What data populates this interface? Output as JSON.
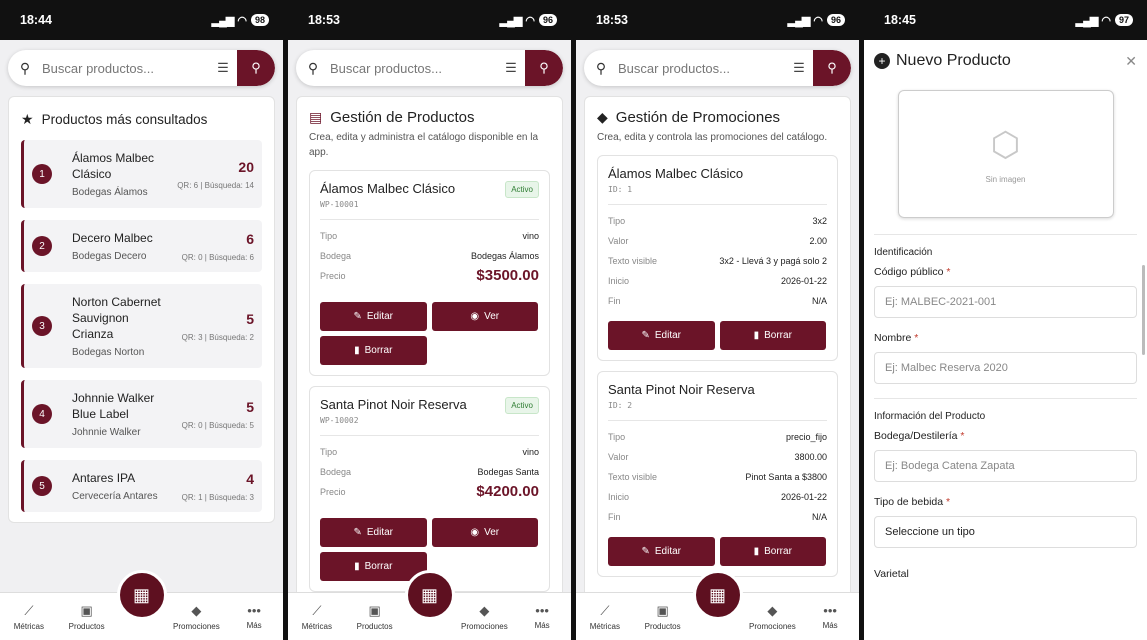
{
  "status": [
    {
      "time": "18:44",
      "battery": "98"
    },
    {
      "time": "18:53",
      "battery": "96"
    },
    {
      "time": "18:53",
      "battery": "96"
    },
    {
      "time": "18:45",
      "battery": "97"
    }
  ],
  "search": {
    "placeholder": "Buscar productos..."
  },
  "nav": {
    "metricas": "Métricas",
    "productos": "Productos",
    "promociones": "Promociones",
    "mas": "Más"
  },
  "top": {
    "title": "Productos más consultados",
    "items": [
      {
        "rank": "1",
        "name": "Álamos Malbec Clásico",
        "brand": "Bodegas Álamos",
        "count": "20",
        "meta": "QR: 6 | Búsqueda: 14"
      },
      {
        "rank": "2",
        "name": "Decero Malbec",
        "brand": "Bodegas Decero",
        "count": "6",
        "meta": "QR: 0 | Búsqueda: 6"
      },
      {
        "rank": "3",
        "name": "Norton Cabernet Sauvignon Crianza",
        "brand": "Bodegas Norton",
        "count": "5",
        "meta": "QR: 3 | Búsqueda: 2"
      },
      {
        "rank": "4",
        "name": "Johnnie Walker Blue Label",
        "brand": "Johnnie Walker",
        "count": "5",
        "meta": "QR: 0 | Búsqueda: 5"
      },
      {
        "rank": "5",
        "name": "Antares IPA",
        "brand": "Cervecería Antares",
        "count": "4",
        "meta": "QR: 1 | Búsqueda: 3"
      }
    ]
  },
  "productos": {
    "title": "Gestión de Productos",
    "subtitle": "Crea, edita y administra el catálogo disponible en la app.",
    "labels": {
      "tipo": "Tipo",
      "bodega": "Bodega",
      "precio": "Precio"
    },
    "items": [
      {
        "name": "Álamos Malbec Clásico",
        "code": "WP-10001",
        "status": "Activo",
        "tipo": "vino",
        "bodega": "Bodegas Álamos",
        "precio": "$3500.00"
      },
      {
        "name": "Santa Pinot Noir Reserva",
        "code": "WP-10002",
        "status": "Activo",
        "tipo": "vino",
        "bodega": "Bodegas Santa",
        "precio": "$4200.00"
      }
    ]
  },
  "promos": {
    "title": "Gestión de Promociones",
    "subtitle": "Crea, edita y controla las promociones del catálogo.",
    "labels": {
      "tipo": "Tipo",
      "valor": "Valor",
      "texto": "Texto visible",
      "inicio": "Inicio",
      "fin": "Fin"
    },
    "items": [
      {
        "name": "Álamos Malbec Clásico",
        "id": "ID: 1",
        "tipo": "3x2",
        "valor": "2.00",
        "texto": "3x2 - Llevá 3 y pagá solo 2",
        "inicio": "2026-01-22",
        "fin": "N/A"
      },
      {
        "name": "Santa Pinot Noir Reserva",
        "id": "ID: 2",
        "tipo": "precio_fijo",
        "valor": "3800.00",
        "texto": "Pinot Santa a $3800",
        "inicio": "2026-01-22",
        "fin": "N/A"
      }
    ]
  },
  "buttons": {
    "editar": "Editar",
    "ver": "Ver",
    "borrar": "Borrar"
  },
  "form": {
    "title": "Nuevo Producto",
    "sin_imagen": "Sin imagen",
    "sect_ident": "Identificación",
    "codigo_label": "Código público",
    "codigo_ph": "Ej: MALBEC-2021-001",
    "nombre_label": "Nombre",
    "nombre_ph": "Ej: Malbec Reserva 2020",
    "sect_info": "Información del Producto",
    "bodega_label": "Bodega/Destilería",
    "bodega_ph": "Ej: Bodega Catena Zapata",
    "tipo_label": "Tipo de bebida",
    "tipo_value": "Seleccione un tipo",
    "varietal_label": "Varietal",
    "req": "*"
  }
}
